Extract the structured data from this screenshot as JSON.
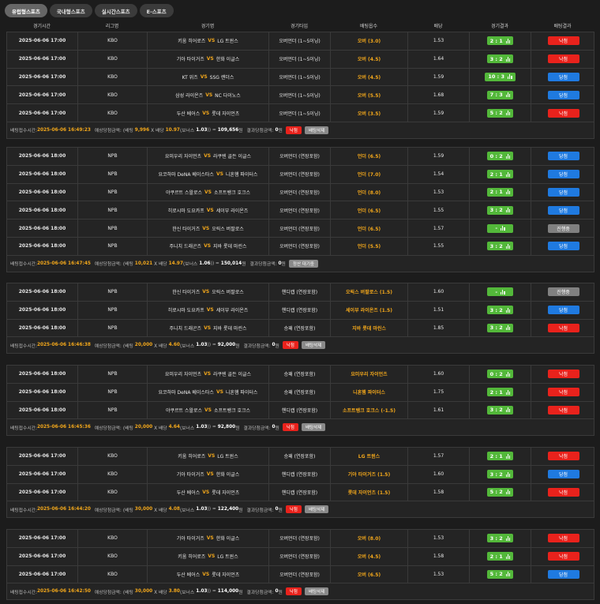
{
  "tabs": [
    "유럽형스포츠",
    "국내형스포츠",
    "실시간스포츠",
    "E-스포츠"
  ],
  "headers": [
    "경기시간",
    "리그명",
    "경기명",
    "경기타입",
    "배팅옵수",
    "배당",
    "경기결과",
    "배팅결과"
  ],
  "vs_label": "VS",
  "labels": {
    "bet_time": "배팅접수시간:",
    "expected_payout": "예상당첨금액:",
    "bet_open": "(배팅",
    "times": "X 배당",
    "bonus_open": "(보너스",
    "paren_close": ")",
    "equals": ") =",
    "won": "원",
    "result_payout": "결과당첨금액:"
  },
  "blocks": [
    {
      "rows": [
        {
          "time": "2025-06-06 17:00",
          "league": "KBO",
          "home": "키움 히어로즈",
          "away": "LG 트윈스",
          "type": "오버언더 (1~5이닝)",
          "pick": "오버 (3.0)",
          "odds": "1.53",
          "score": "2 : 1",
          "status": "낙첨",
          "st": "lose"
        },
        {
          "time": "2025-06-06 17:00",
          "league": "KBO",
          "home": "기아 타이거즈",
          "away": "한화 이글스",
          "type": "오버언더 (1~5이닝)",
          "pick": "오버 (4.5)",
          "odds": "1.64",
          "score": "3 : 2",
          "status": "낙첨",
          "st": "lose"
        },
        {
          "time": "2025-06-06 17:00",
          "league": "KBO",
          "home": "KT 위즈",
          "away": "SSG 랜더스",
          "type": "오버언더 (1~5이닝)",
          "pick": "오버 (4.5)",
          "odds": "1.59",
          "score": "10 : 3",
          "status": "당첨",
          "st": "win"
        },
        {
          "time": "2025-06-06 17:00",
          "league": "KBO",
          "home": "삼성 라이온즈",
          "away": "NC 다이노스",
          "type": "오버언더 (1~5이닝)",
          "pick": "오버 (5.5)",
          "odds": "1.68",
          "score": "7 : 3",
          "status": "당첨",
          "st": "win"
        },
        {
          "time": "2025-06-06 17:00",
          "league": "KBO",
          "home": "두산 베어스",
          "away": "롯데 자이언츠",
          "type": "오버언더 (1~5이닝)",
          "pick": "오버 (3.5)",
          "odds": "1.59",
          "score": "5 : 2",
          "status": "낙첨",
          "st": "lose"
        }
      ],
      "summary": {
        "time": "2025-06-06 16:49:23",
        "bet": "9,996",
        "odds": "10.97",
        "bonus": "1.03",
        "expected": "109,656",
        "result": "0",
        "badge1": "낙첨",
        "badge2": "배팅삭제",
        "badge1_type": "red"
      }
    },
    {
      "rows": [
        {
          "time": "2025-06-06 18:00",
          "league": "NPB",
          "home": "요미우리 자이언츠",
          "away": "라쿠텐 골든 이글스",
          "type": "오버언더 (연장포함)",
          "pick": "언더 (6.5)",
          "odds": "1.59",
          "score": "0 : 2",
          "status": "당첨",
          "st": "win"
        },
        {
          "time": "2025-06-06 18:00",
          "league": "NPB",
          "home": "요코하마 DeNA 베이스타스",
          "away": "니혼햄 파이터스",
          "type": "오버언더 (연장포함)",
          "pick": "언더 (7.0)",
          "odds": "1.54",
          "score": "2 : 1",
          "status": "당첨",
          "st": "win"
        },
        {
          "time": "2025-06-06 18:00",
          "league": "NPB",
          "home": "야쿠르트 스왈로스",
          "away": "소프트뱅크 호크스",
          "type": "오버언더 (연장포함)",
          "pick": "언더 (8.0)",
          "odds": "1.53",
          "score": "2 : 1",
          "status": "당첨",
          "st": "win"
        },
        {
          "time": "2025-06-06 18:00",
          "league": "NPB",
          "home": "히로시마 도요카프",
          "away": "세이부 라이온즈",
          "type": "오버언더 (연장포함)",
          "pick": "언더 (6.5)",
          "odds": "1.55",
          "score": "3 : 2",
          "status": "당첨",
          "st": "win"
        },
        {
          "time": "2025-06-06 18:00",
          "league": "NPB",
          "home": "한신 타이거즈",
          "away": "오릭스 버팔로스",
          "type": "오버언더 (연장포함)",
          "pick": "언더 (6.5)",
          "odds": "1.57",
          "score": "-",
          "status": "진행중",
          "st": "pend"
        },
        {
          "time": "2025-06-06 18:00",
          "league": "NPB",
          "home": "주니치 드래곤즈",
          "away": "지바 롯데 마린스",
          "type": "오버언더 (연장포함)",
          "pick": "언더 (5.5)",
          "odds": "1.55",
          "score": "3 : 2",
          "status": "당첨",
          "st": "win"
        }
      ],
      "summary": {
        "time": "2025-06-06 16:47:45",
        "bet": "10,021",
        "odds": "14.97",
        "bonus": "1.06",
        "expected": "150,014",
        "result": "0",
        "badge1": "정산 대기중",
        "badge2": "",
        "badge1_type": "gray"
      }
    },
    {
      "rows": [
        {
          "time": "2025-06-06 18:00",
          "league": "NPB",
          "home": "한신 타이거즈",
          "away": "오릭스 버팔로스",
          "type": "핸디캡 (연장포함)",
          "pick": "오릭스 버팔로스 (1.5)",
          "odds": "1.60",
          "score": "-",
          "status": "진행중",
          "st": "pend"
        },
        {
          "time": "2025-06-06 18:00",
          "league": "NPB",
          "home": "히로시마 도요카프",
          "away": "세이부 라이온즈",
          "type": "핸디캡 (연장포함)",
          "pick": "세이부 라이온즈 (1.5)",
          "odds": "1.51",
          "score": "3 : 2",
          "status": "당첨",
          "st": "win"
        },
        {
          "time": "2025-06-06 18:00",
          "league": "NPB",
          "home": "주니치 드래곤즈",
          "away": "지바 롯데 마린스",
          "type": "승패 (연장포함)",
          "pick": "지바 롯데 마린스",
          "odds": "1.85",
          "score": "3 : 2",
          "status": "낙첨",
          "st": "lose"
        }
      ],
      "summary": {
        "time": "2025-06-06 16:46:38",
        "bet": "20,000",
        "odds": "4.60",
        "bonus": "1.03",
        "expected": "92,000",
        "result": "0",
        "badge1": "낙첨",
        "badge2": "배팅삭제",
        "badge1_type": "red"
      }
    },
    {
      "rows": [
        {
          "time": "2025-06-06 18:00",
          "league": "NPB",
          "home": "요미우리 자이언츠",
          "away": "라쿠텐 골든 이글스",
          "type": "승패 (연장포함)",
          "pick": "요미우리 자이언츠",
          "odds": "1.60",
          "score": "0 : 2",
          "status": "낙첨",
          "st": "lose"
        },
        {
          "time": "2025-06-06 18:00",
          "league": "NPB",
          "home": "요코하마 DeNA 베이스타스",
          "away": "니혼햄 파이터스",
          "type": "승패 (연장포함)",
          "pick": "니혼햄 파이터스",
          "odds": "1.75",
          "score": "2 : 1",
          "status": "낙첨",
          "st": "lose"
        },
        {
          "time": "2025-06-06 18:00",
          "league": "NPB",
          "home": "야쿠르트 스왈로스",
          "away": "소프트뱅크 호크스",
          "type": "핸디캡 (연장포함)",
          "pick": "소프트뱅크 호크스 (-1.5)",
          "odds": "1.61",
          "score": "3 : 2",
          "status": "낙첨",
          "st": "lose"
        }
      ],
      "summary": {
        "time": "2025-06-06 16:45:36",
        "bet": "20,000",
        "odds": "4.64",
        "bonus": "1.03",
        "expected": "92,800",
        "result": "0",
        "badge1": "낙첨",
        "badge2": "배팅삭제",
        "badge1_type": "red"
      }
    },
    {
      "rows": [
        {
          "time": "2025-06-06 17:00",
          "league": "KBO",
          "home": "키움 히어로즈",
          "away": "LG 트윈스",
          "type": "승패 (연장포함)",
          "pick": "LG 트윈스",
          "odds": "1.57",
          "score": "2 : 1",
          "status": "낙첨",
          "st": "lose"
        },
        {
          "time": "2025-06-06 17:00",
          "league": "KBO",
          "home": "기아 타이거즈",
          "away": "한화 이글스",
          "type": "핸디캡 (연장포함)",
          "pick": "기아 타이거즈 (1.5)",
          "odds": "1.60",
          "score": "3 : 2",
          "status": "당첨",
          "st": "win"
        },
        {
          "time": "2025-06-06 17:00",
          "league": "KBO",
          "home": "두산 베어스",
          "away": "롯데 자이언츠",
          "type": "핸디캡 (연장포함)",
          "pick": "롯데 자이언츠 (1.5)",
          "odds": "1.58",
          "score": "5 : 2",
          "status": "낙첨",
          "st": "lose"
        }
      ],
      "summary": {
        "time": "2025-06-06 16:44:20",
        "bet": "30,000",
        "odds": "4.08",
        "bonus": "1.03",
        "expected": "122,400",
        "result": "0",
        "badge1": "낙첨",
        "badge2": "배팅삭제",
        "badge1_type": "red"
      }
    },
    {
      "rows": [
        {
          "time": "2025-06-06 17:00",
          "league": "KBO",
          "home": "기아 타이거즈",
          "away": "한화 이글스",
          "type": "오버언더 (연장포함)",
          "pick": "오버 (8.0)",
          "odds": "1.53",
          "score": "3 : 2",
          "status": "낙첨",
          "st": "lose"
        },
        {
          "time": "2025-06-06 17:00",
          "league": "KBO",
          "home": "키움 히어로즈",
          "away": "LG 트윈스",
          "type": "오버언더 (연장포함)",
          "pick": "오버 (4.5)",
          "odds": "1.58",
          "score": "2 : 1",
          "status": "낙첨",
          "st": "lose"
        },
        {
          "time": "2025-06-06 17:00",
          "league": "KBO",
          "home": "두산 베어스",
          "away": "롯데 자이언츠",
          "type": "오버언더 (연장포함)",
          "pick": "오버 (6.5)",
          "odds": "1.53",
          "score": "5 : 2",
          "status": "당첨",
          "st": "win"
        }
      ],
      "summary": {
        "time": "2025-06-06 16:42:50",
        "bet": "30,000",
        "odds": "3.80",
        "bonus": "1.03",
        "expected": "114,000",
        "result": "0",
        "badge1": "낙첨",
        "badge2": "배팅삭제",
        "badge1_type": "red"
      }
    }
  ],
  "colors": {
    "accent": "#f2a71b",
    "win": "#1f7ae0",
    "lose": "#e9221c",
    "score": "#53b83a",
    "pending": "#808080"
  }
}
